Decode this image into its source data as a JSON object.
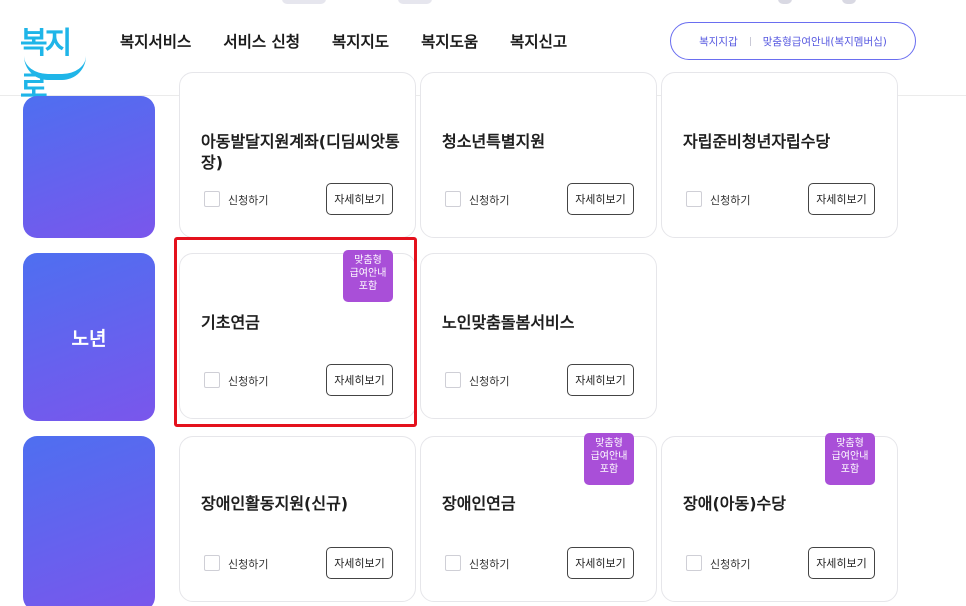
{
  "header": {
    "logo_text": "복지로",
    "nav": [
      "복지서비스",
      "서비스 신청",
      "복지지도",
      "복지도움",
      "복지신고"
    ],
    "pill": {
      "left": "복지지갑",
      "right": "맞춤형급여안내(복지멤버십)"
    }
  },
  "categories": {
    "row2_label": "노년"
  },
  "common": {
    "apply_label": "신청하기",
    "detail_label": "자세히보기",
    "badge_text": "맞춤형\n급여안내\n포함"
  },
  "cards": {
    "r1c1": "아동발달지원계좌(디딤씨앗통장)",
    "r1c2": "청소년특별지원",
    "r1c3": "자립준비청년자립수당",
    "r2c1": "기초연금",
    "r2c2": "노인맞춤돌봄서비스",
    "r3c1": "장애인활동지원(신규)",
    "r3c2": "장애인연금",
    "r3c3": "장애(아동)수당"
  },
  "colors": {
    "accent": "#5658e0",
    "badge": "#a94fd8",
    "highlight": "#e4111d"
  }
}
